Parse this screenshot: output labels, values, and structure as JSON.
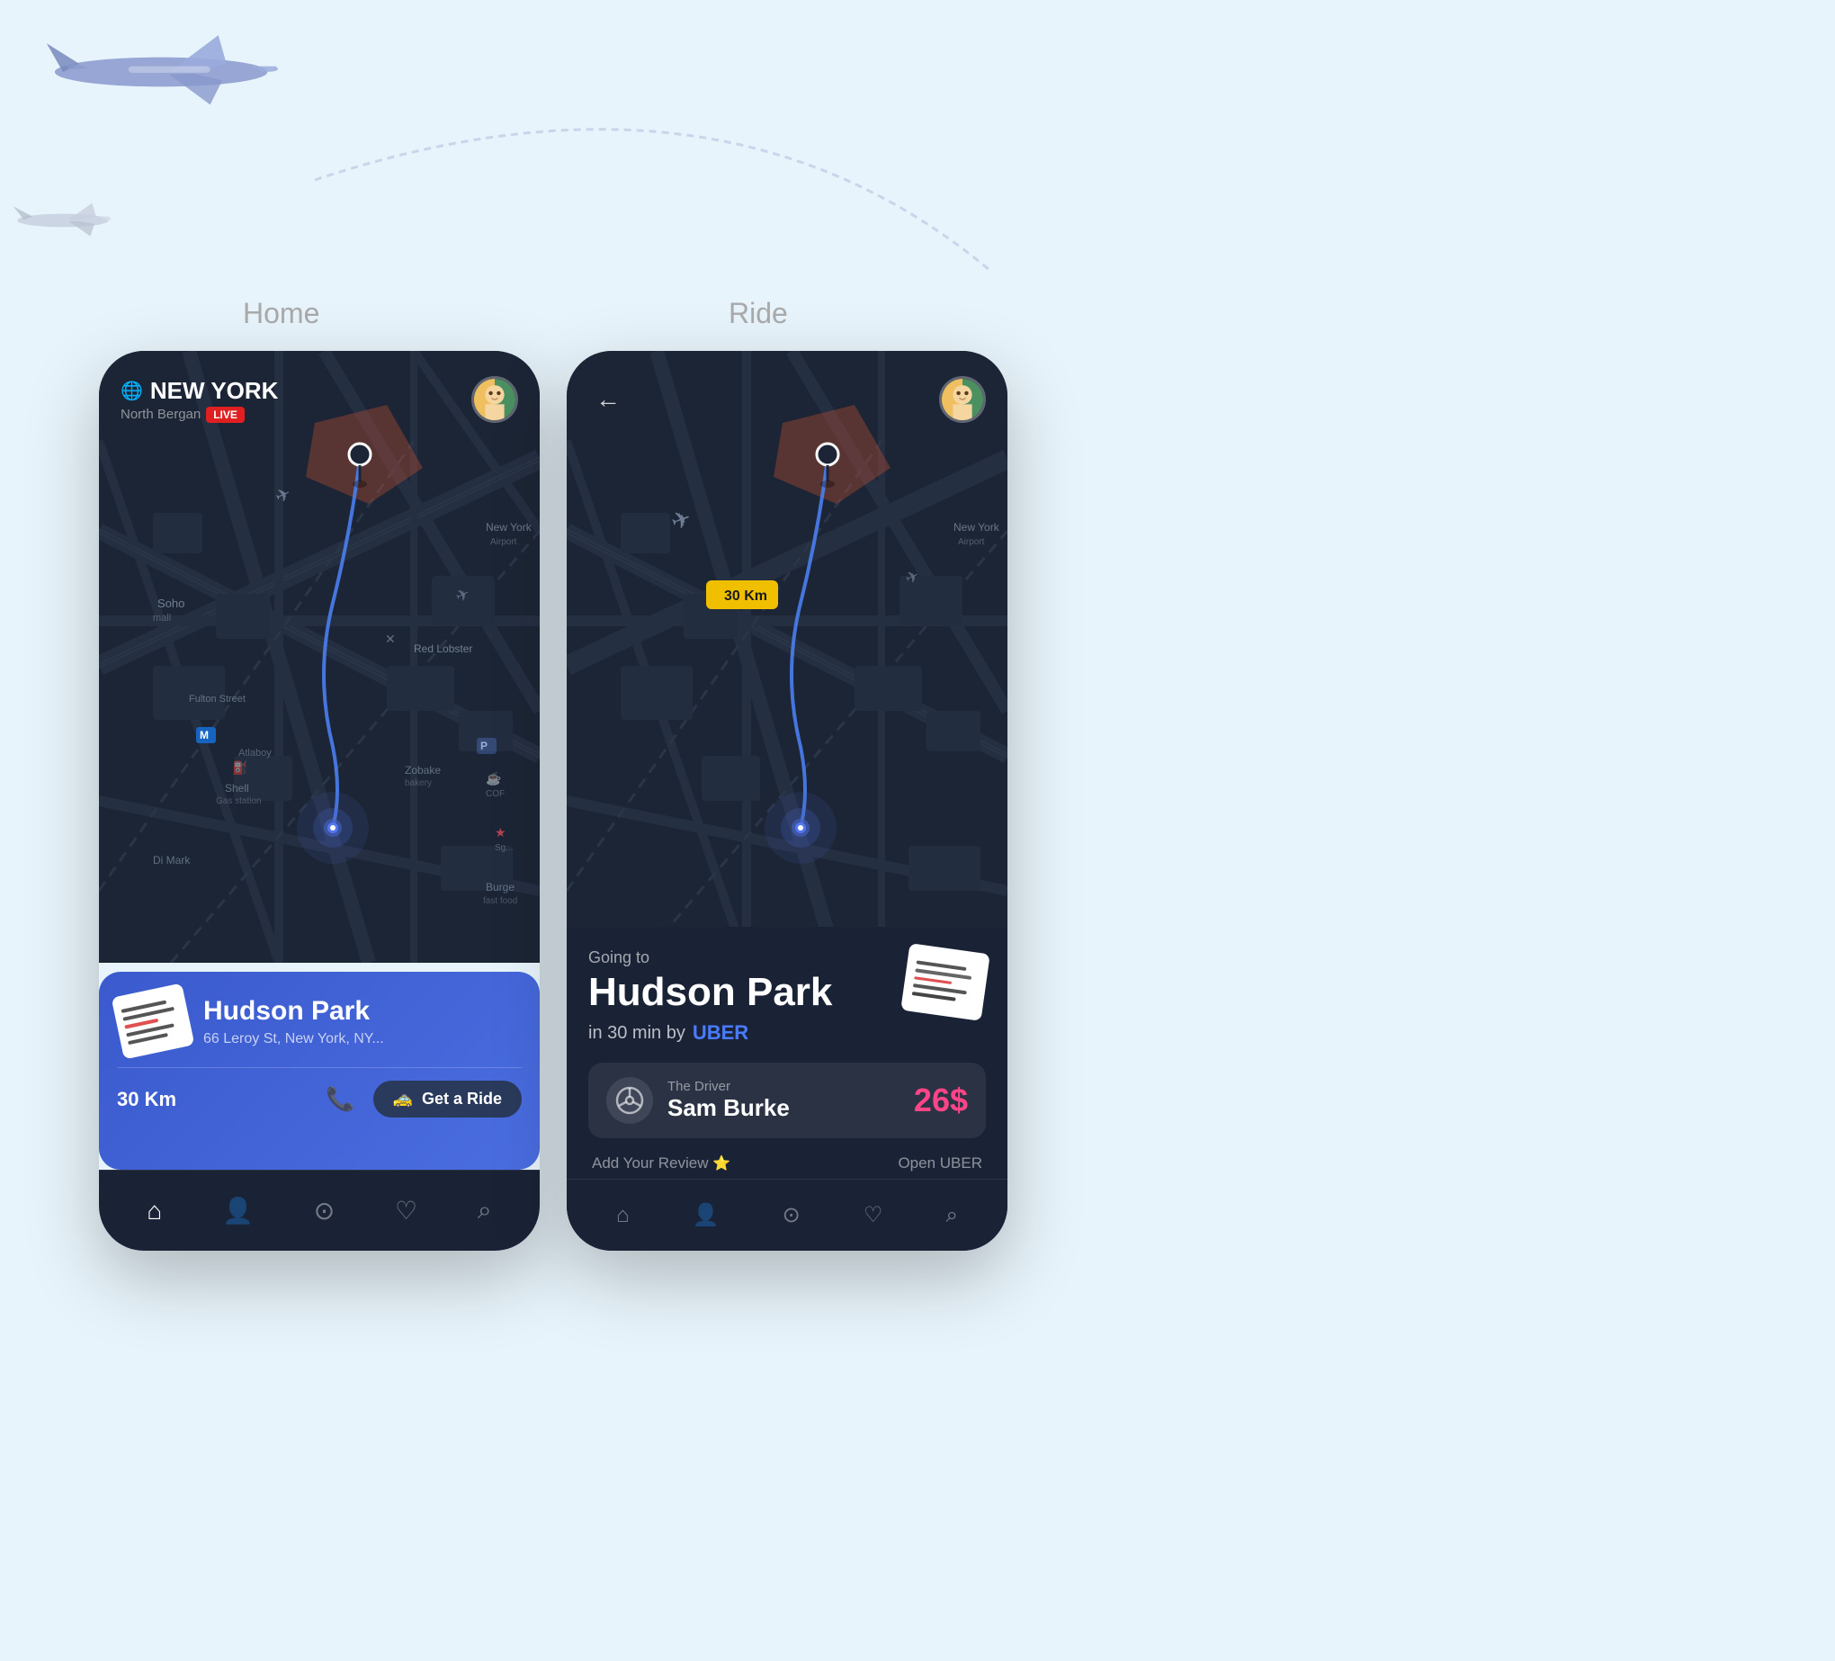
{
  "background": "#e8f4fb",
  "labels": {
    "home": "Home",
    "ride": "Ride"
  },
  "left_phone": {
    "city": "NEW YORK",
    "live_badge": "LIVE",
    "sub_location": "North Bergan",
    "map_labels": [
      "Soho",
      "Fulton Street",
      "Shell",
      "Di Mark",
      "Red Lobster",
      "Atlaboy",
      "P",
      "Zobake",
      "Burge",
      "New York"
    ],
    "distance_label": "30 Km",
    "destination": "Hudson Park",
    "address": "66 Leroy St, New York, NY...",
    "phone_icon": "📞",
    "get_ride_label": "Get a Ride",
    "nav_icons": [
      "🏠",
      "👤",
      "🎯",
      "❤",
      "🔍"
    ]
  },
  "right_phone": {
    "going_to_label": "Going to",
    "destination": "Hudson Park",
    "eta": "in 30 min by",
    "service": "UBER",
    "distance_badge": "30 Km",
    "driver_label": "The Driver",
    "driver_name": "Sam Burke",
    "price": "26$",
    "review_label": "Add Your Review",
    "open_uber_label": "Open UBER",
    "nav_icons": [
      "🏠",
      "👤",
      "🎯",
      "❤",
      "🔍"
    ]
  }
}
